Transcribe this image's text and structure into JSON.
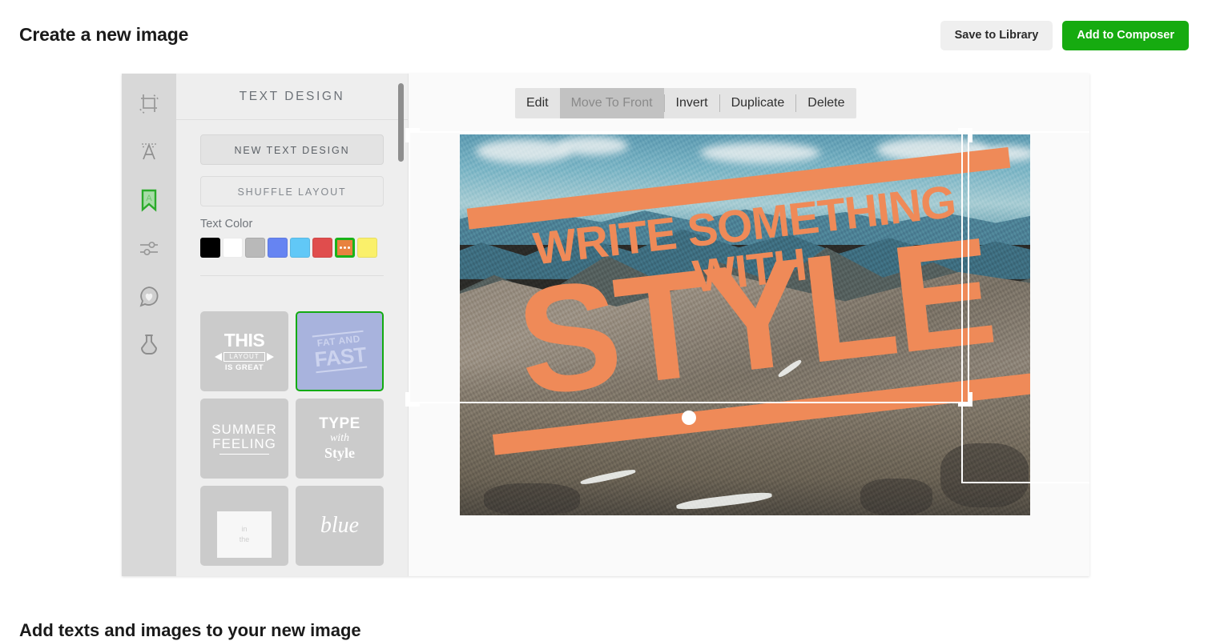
{
  "header": {
    "title": "Create a new image",
    "save_label": "Save to Library",
    "add_label": "Add to Composer",
    "primary_color": "#16ab10"
  },
  "tool_rail": {
    "items": [
      {
        "name": "crop-icon",
        "label": "Crop",
        "active": false
      },
      {
        "name": "text-icon",
        "label": "Text",
        "active": false
      },
      {
        "name": "text-design-icon",
        "label": "Text Design",
        "active": true
      },
      {
        "name": "adjust-icon",
        "label": "Adjust",
        "active": false
      },
      {
        "name": "sticker-icon",
        "label": "Sticker",
        "active": false
      },
      {
        "name": "filter-icon",
        "label": "Filter",
        "active": false
      }
    ],
    "active_color": "#2eab2e"
  },
  "panel": {
    "heading": "TEXT DESIGN",
    "new_text_design_label": "NEW TEXT DESIGN",
    "shuffle_layout_label": "SHUFFLE LAYOUT",
    "text_color_label": "Text Color",
    "swatches": [
      {
        "name": "black",
        "hex": "#000000",
        "selected": false
      },
      {
        "name": "white",
        "hex": "#ffffff",
        "selected": false
      },
      {
        "name": "gray",
        "hex": "#b9b9b9",
        "selected": false
      },
      {
        "name": "blue",
        "hex": "#6684f2",
        "selected": false
      },
      {
        "name": "sky",
        "hex": "#61c8f7",
        "selected": false
      },
      {
        "name": "red",
        "hex": "#e04d4d",
        "selected": false
      },
      {
        "name": "orange",
        "hex": "#e8823f",
        "selected": true
      },
      {
        "name": "yellow",
        "hex": "#faf06a",
        "selected": false
      }
    ],
    "selected_border_color": "#19b218",
    "templates": [
      {
        "id": "this-layout-is-great",
        "line1": "THIS",
        "line2": "LAYOUT",
        "line3": "IS GREAT",
        "selected": false
      },
      {
        "id": "fat-and-fast",
        "line1": "FAT AND",
        "line2": "FAST",
        "selected": true
      },
      {
        "id": "summer-feeling",
        "line1": "SUMMER",
        "line2": "FEELING",
        "selected": false
      },
      {
        "id": "type-with-style",
        "line1": "TYPE",
        "line2": "with",
        "line3": "Style",
        "selected": false
      },
      {
        "id": "in-the-box",
        "line1": "in",
        "line2": "the",
        "selected": false
      },
      {
        "id": "blue",
        "line1": "blue",
        "selected": false
      }
    ]
  },
  "canvas": {
    "context_menu": [
      {
        "label": "Edit",
        "hovered": false
      },
      {
        "label": "Move To Front",
        "hovered": true
      },
      {
        "label": "Invert",
        "hovered": false
      },
      {
        "label": "Duplicate",
        "hovered": false
      },
      {
        "label": "Delete",
        "hovered": false
      }
    ],
    "overlay_text": {
      "line1": "WRITE SOMETHING WITH",
      "line2": "STYLE",
      "color": "#ef8a58",
      "rotation_deg": -6.5
    },
    "selection": {
      "handle_color": "#ffffff",
      "rotate_handle": "rotate-handle"
    }
  },
  "footer": {
    "title": "Add texts and images to your new image"
  }
}
